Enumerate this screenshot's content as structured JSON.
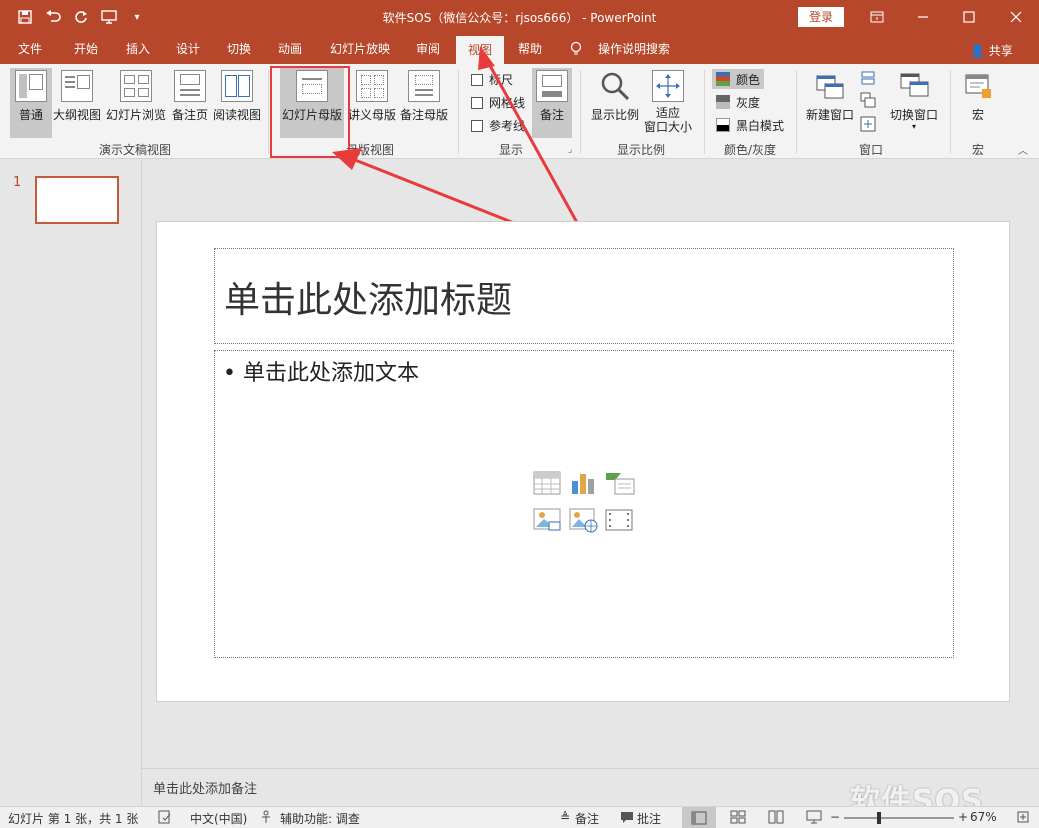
{
  "titlebar": {
    "title": "软件SOS（微信公众号：rjsos666） - PowerPoint",
    "login": "登录"
  },
  "tabs": [
    "文件",
    "开始",
    "插入",
    "设计",
    "切换",
    "动画",
    "幻灯片放映",
    "审阅",
    "视图",
    "帮助",
    "操作说明搜索"
  ],
  "share": "共享",
  "ribbon": {
    "views": [
      "普通",
      "大纲视图",
      "幻灯片浏览",
      "备注页",
      "阅读视图"
    ],
    "views_group": "演示文稿视图",
    "masters": [
      "幻灯片母版",
      "讲义母版",
      "备注母版"
    ],
    "masters_group": "母版视图",
    "show": [
      "标尺",
      "网格线",
      "参考线"
    ],
    "notes_btn": "备注",
    "show_group": "显示",
    "zoom": [
      "显示比例",
      "适应\n窗口大小"
    ],
    "zoom_fit_line1": "适应",
    "zoom_fit_line2": "窗口大小",
    "zoom_group": "显示比例",
    "colors": [
      "颜色",
      "灰度",
      "黑白模式"
    ],
    "colors_group": "颜色/灰度",
    "window": [
      "新建窗口",
      "切换窗口"
    ],
    "window_group": "窗口",
    "macro": "宏",
    "macro_group": "宏"
  },
  "thumbs": {
    "number": "1"
  },
  "slide": {
    "title_placeholder": "单击此处添加标题",
    "body_placeholder": "• 单击此处添加文本"
  },
  "notes": "单击此处添加备注",
  "status": {
    "slide_info": "幻灯片 第 1 张，共 1 张",
    "language": "中文(中国)",
    "accessibility": "辅助功能: 调查",
    "notes": "备注",
    "comments": "批注",
    "zoom": "67%"
  },
  "watermark": "软件SOS",
  "colors": {
    "accent": "#b7472a",
    "highlight": "#e83b3b"
  }
}
